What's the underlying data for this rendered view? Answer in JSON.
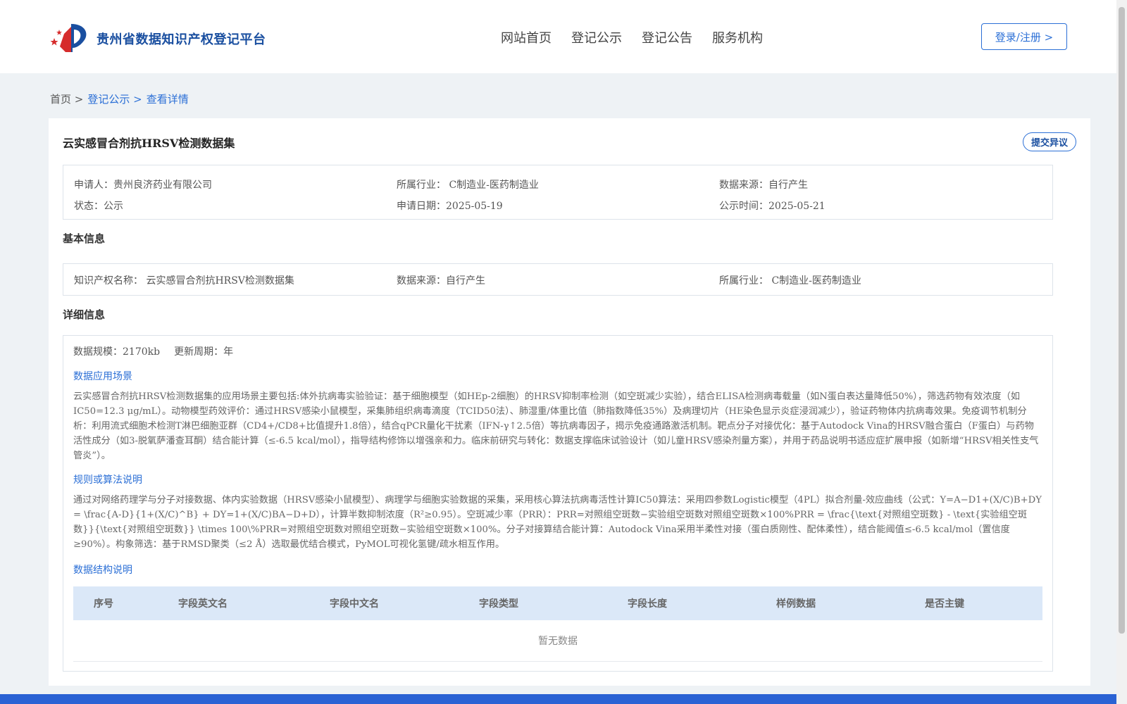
{
  "header": {
    "site_title": "贵州省数据知识产权登记平台",
    "nav": [
      "网站首页",
      "登记公示",
      "登记公告",
      "服务机构"
    ],
    "login_label": "登录/注册 >"
  },
  "breadcrumb": {
    "home": "首页 >",
    "section": "登记公示 >",
    "current": "查看详情"
  },
  "page": {
    "title": "云实感冒合剂抗HRSV检测数据集",
    "objection_label": "提交异议"
  },
  "summary": {
    "applicant": "申请人：贵州良济药业有限公司",
    "industry": "所属行业： C制造业-医药制造业",
    "source": "数据来源：自行产生",
    "status": "状态：公示",
    "apply_date": "申请日期：2025-05-19",
    "publish_date": "公示时间：2025-05-21"
  },
  "basic": {
    "title": "基本信息",
    "ip_name": "知识产权名称： 云实感冒合剂抗HRSV检测数据集",
    "source": "数据来源：自行产生",
    "industry": "所属行业： C制造业-医药制造业"
  },
  "detail": {
    "title": "详细信息",
    "scale": "数据规模：2170kb",
    "cycle": "更新周期：年",
    "scene_title": "数据应用场景",
    "scene_text": "云实感冒合剂抗HRSV检测数据集的应用场景主要包括:体外抗病毒实验验证：基于细胞模型（如HEp-2细胞）的HRSV抑制率检测（如空斑减少实验），结合ELISA检测病毒载量（如N蛋白表达量降低50%），筛选药物有效浓度（如IC50=12.3 μg/mL）。动物模型药效评价：通过HRSV感染小鼠模型，采集肺组织病毒滴度（TCID50法）、肺湿重/体重比值（肺指数降低35%）及病理切片（HE染色显示炎症浸润减少），验证药物体内抗病毒效果。免疫调节机制分析：利用流式细胞术检测T淋巴细胞亚群（CD4+/CD8+比值提升1.8倍），结合qPCR量化干扰素（IFN-γ↑2.5倍）等抗病毒因子，揭示免疫通路激活机制。靶点分子对接优化：基于Autodock Vina的HRSV融合蛋白（F蛋白）与药物活性成分（如3-脱氧萨潘查耳酮）结合能计算（≤-6.5 kcal/mol），指导结构修饰以增强亲和力。临床前研究与转化：数据支撑临床试验设计（如儿童HRSV感染剂量方案），并用于药品说明书适应症扩展申报（如新增“HRSV相关性支气管炎”）。",
    "algo_title": "规则或算法说明",
    "algo_text": "通过对网络药理学与分子对接数据、体内实验数据（HRSV感染小鼠模型）、病理学与细胞实验数据的采集，采用核心算法抗病毒活性计算IC50算法：采用四参数Logistic模型（4PL）拟合剂量-效应曲线（公式：Y=A−D1+(X/C)B+DY = \\frac{A-D}{1+(X/C)^B} + DY=1+(X/C)BA−D+D），计算半数抑制浓度（R²≥0.95）。空斑减少率（PRR）：PRR=对照组空斑数−实验组空斑数对照组空斑数×100%PRR = \\frac{\\text{对照组空斑数} - \\text{实验组空斑数}}{\\text{对照组空斑数}} \\times 100\\%PRR=对照组空斑数对照组空斑数−实验组空斑数×100%。分子对接算结合能计算：Autodock Vina采用半柔性对接（蛋白质刚性、配体柔性），结合能阈值≤-6.5 kcal/mol（置信度≥90%）。构象筛选：基于RMSD聚类（≤2 Å）选取最优结合模式，PyMOL可视化氢键/疏水相互作用。",
    "struct_title": "数据结构说明",
    "table_headers": [
      "序号",
      "字段英文名",
      "字段中文名",
      "字段类型",
      "字段长度",
      "样例数据",
      "是否主键"
    ],
    "empty_text": "暂无数据"
  },
  "colors": {
    "accent": "#2b6fd6",
    "brand": "#1a4fa0",
    "table_header_bg": "#dbe8f8",
    "footer": "#2a62d4"
  }
}
